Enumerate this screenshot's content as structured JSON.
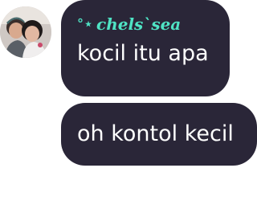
{
  "chat": {
    "sender_name": "chels`sea",
    "sender_decoration": "°⋆",
    "messages": [
      {
        "text": "kocil itu apa"
      },
      {
        "text": "oh kontol kecil"
      }
    ]
  },
  "colors": {
    "bubble": "#2a2638",
    "sender_name": "#4fe3c4",
    "message_text": "#ffffff",
    "background": "#ffffff"
  }
}
